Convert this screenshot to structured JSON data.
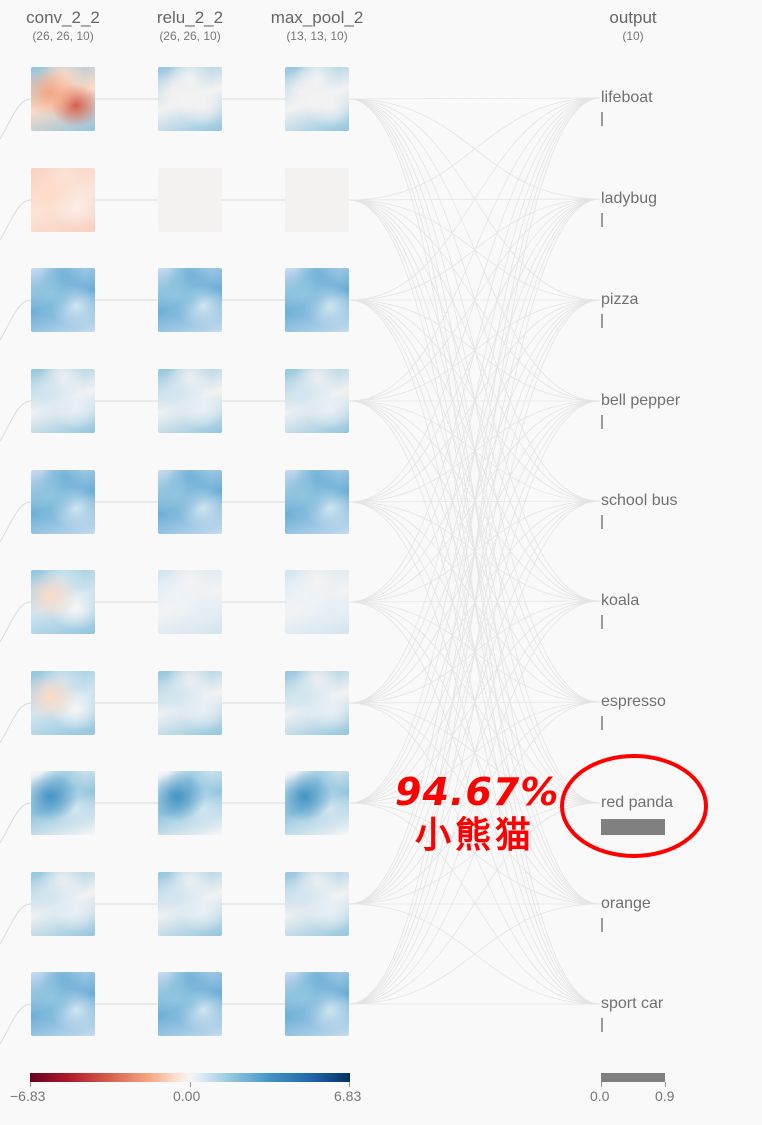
{
  "columns": [
    {
      "name": "conv_2_2",
      "shape": "(26, 26, 10)"
    },
    {
      "name": "relu_2_2",
      "shape": "(26, 26, 10)"
    },
    {
      "name": "max_pool_2",
      "shape": "(13, 13, 10)"
    },
    {
      "name": "output",
      "shape": "(10)"
    }
  ],
  "classes": [
    {
      "label": "lifeboat",
      "probability": 0.0
    },
    {
      "label": "ladybug",
      "probability": 0.0
    },
    {
      "label": "pizza",
      "probability": 0.0
    },
    {
      "label": "bell pepper",
      "probability": 0.0
    },
    {
      "label": "school bus",
      "probability": 0.0
    },
    {
      "label": "koala",
      "probability": 0.0
    },
    {
      "label": "espresso",
      "probability": 0.0
    },
    {
      "label": "red panda",
      "probability": 0.9467
    },
    {
      "label": "orange",
      "probability": 0.0
    },
    {
      "label": "sport car",
      "probability": 0.0
    }
  ],
  "feature_maps": {
    "conv": [
      "mixed-red",
      "light-red",
      "blue",
      "light-blue",
      "blue",
      "mixed-light",
      "mixed-light",
      "mixed-blue",
      "light-blue",
      "blue"
    ],
    "relu": [
      "sparse-blue",
      "empty",
      "blue",
      "light-blue",
      "blue",
      "faint-blue",
      "light-blue",
      "mixed-blue",
      "light-blue",
      "blue"
    ],
    "pool": [
      "sparse-blue",
      "empty",
      "blue",
      "light-blue",
      "blue",
      "faint-blue",
      "light-blue",
      "mixed-blue",
      "light-blue",
      "blue"
    ]
  },
  "legend": {
    "min_label": "−6.83",
    "mid_label": "0.00",
    "max_label": "6.83",
    "output_min_label": "0.0",
    "output_max_label": "0.9"
  },
  "annotation": {
    "percent": "94.67%",
    "chinese": "小熊猫",
    "color": "#ff0000"
  },
  "colors": {
    "bar": "#808080",
    "line": "#dcdcdc",
    "neg": "#d6604d",
    "pos": "#4393c3"
  }
}
